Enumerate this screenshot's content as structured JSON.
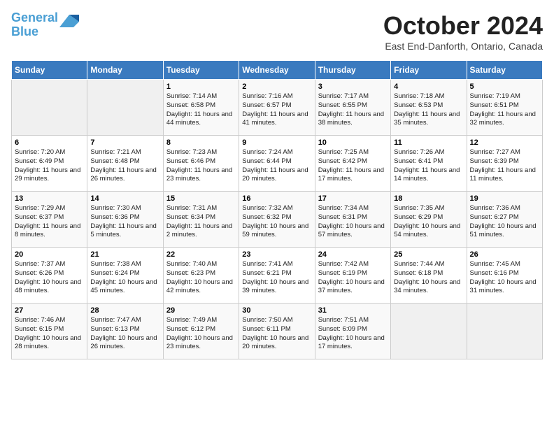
{
  "header": {
    "logo_line1": "General",
    "logo_line2": "Blue",
    "title": "October 2024",
    "subtitle": "East End-Danforth, Ontario, Canada"
  },
  "weekdays": [
    "Sunday",
    "Monday",
    "Tuesday",
    "Wednesday",
    "Thursday",
    "Friday",
    "Saturday"
  ],
  "weeks": [
    [
      {
        "day": "",
        "info": ""
      },
      {
        "day": "",
        "info": ""
      },
      {
        "day": "1",
        "info": "Sunrise: 7:14 AM\nSunset: 6:58 PM\nDaylight: 11 hours and 44 minutes."
      },
      {
        "day": "2",
        "info": "Sunrise: 7:16 AM\nSunset: 6:57 PM\nDaylight: 11 hours and 41 minutes."
      },
      {
        "day": "3",
        "info": "Sunrise: 7:17 AM\nSunset: 6:55 PM\nDaylight: 11 hours and 38 minutes."
      },
      {
        "day": "4",
        "info": "Sunrise: 7:18 AM\nSunset: 6:53 PM\nDaylight: 11 hours and 35 minutes."
      },
      {
        "day": "5",
        "info": "Sunrise: 7:19 AM\nSunset: 6:51 PM\nDaylight: 11 hours and 32 minutes."
      }
    ],
    [
      {
        "day": "6",
        "info": "Sunrise: 7:20 AM\nSunset: 6:49 PM\nDaylight: 11 hours and 29 minutes."
      },
      {
        "day": "7",
        "info": "Sunrise: 7:21 AM\nSunset: 6:48 PM\nDaylight: 11 hours and 26 minutes."
      },
      {
        "day": "8",
        "info": "Sunrise: 7:23 AM\nSunset: 6:46 PM\nDaylight: 11 hours and 23 minutes."
      },
      {
        "day": "9",
        "info": "Sunrise: 7:24 AM\nSunset: 6:44 PM\nDaylight: 11 hours and 20 minutes."
      },
      {
        "day": "10",
        "info": "Sunrise: 7:25 AM\nSunset: 6:42 PM\nDaylight: 11 hours and 17 minutes."
      },
      {
        "day": "11",
        "info": "Sunrise: 7:26 AM\nSunset: 6:41 PM\nDaylight: 11 hours and 14 minutes."
      },
      {
        "day": "12",
        "info": "Sunrise: 7:27 AM\nSunset: 6:39 PM\nDaylight: 11 hours and 11 minutes."
      }
    ],
    [
      {
        "day": "13",
        "info": "Sunrise: 7:29 AM\nSunset: 6:37 PM\nDaylight: 11 hours and 8 minutes."
      },
      {
        "day": "14",
        "info": "Sunrise: 7:30 AM\nSunset: 6:36 PM\nDaylight: 11 hours and 5 minutes."
      },
      {
        "day": "15",
        "info": "Sunrise: 7:31 AM\nSunset: 6:34 PM\nDaylight: 11 hours and 2 minutes."
      },
      {
        "day": "16",
        "info": "Sunrise: 7:32 AM\nSunset: 6:32 PM\nDaylight: 10 hours and 59 minutes."
      },
      {
        "day": "17",
        "info": "Sunrise: 7:34 AM\nSunset: 6:31 PM\nDaylight: 10 hours and 57 minutes."
      },
      {
        "day": "18",
        "info": "Sunrise: 7:35 AM\nSunset: 6:29 PM\nDaylight: 10 hours and 54 minutes."
      },
      {
        "day": "19",
        "info": "Sunrise: 7:36 AM\nSunset: 6:27 PM\nDaylight: 10 hours and 51 minutes."
      }
    ],
    [
      {
        "day": "20",
        "info": "Sunrise: 7:37 AM\nSunset: 6:26 PM\nDaylight: 10 hours and 48 minutes."
      },
      {
        "day": "21",
        "info": "Sunrise: 7:38 AM\nSunset: 6:24 PM\nDaylight: 10 hours and 45 minutes."
      },
      {
        "day": "22",
        "info": "Sunrise: 7:40 AM\nSunset: 6:23 PM\nDaylight: 10 hours and 42 minutes."
      },
      {
        "day": "23",
        "info": "Sunrise: 7:41 AM\nSunset: 6:21 PM\nDaylight: 10 hours and 39 minutes."
      },
      {
        "day": "24",
        "info": "Sunrise: 7:42 AM\nSunset: 6:19 PM\nDaylight: 10 hours and 37 minutes."
      },
      {
        "day": "25",
        "info": "Sunrise: 7:44 AM\nSunset: 6:18 PM\nDaylight: 10 hours and 34 minutes."
      },
      {
        "day": "26",
        "info": "Sunrise: 7:45 AM\nSunset: 6:16 PM\nDaylight: 10 hours and 31 minutes."
      }
    ],
    [
      {
        "day": "27",
        "info": "Sunrise: 7:46 AM\nSunset: 6:15 PM\nDaylight: 10 hours and 28 minutes."
      },
      {
        "day": "28",
        "info": "Sunrise: 7:47 AM\nSunset: 6:13 PM\nDaylight: 10 hours and 26 minutes."
      },
      {
        "day": "29",
        "info": "Sunrise: 7:49 AM\nSunset: 6:12 PM\nDaylight: 10 hours and 23 minutes."
      },
      {
        "day": "30",
        "info": "Sunrise: 7:50 AM\nSunset: 6:11 PM\nDaylight: 10 hours and 20 minutes."
      },
      {
        "day": "31",
        "info": "Sunrise: 7:51 AM\nSunset: 6:09 PM\nDaylight: 10 hours and 17 minutes."
      },
      {
        "day": "",
        "info": ""
      },
      {
        "day": "",
        "info": ""
      }
    ]
  ]
}
